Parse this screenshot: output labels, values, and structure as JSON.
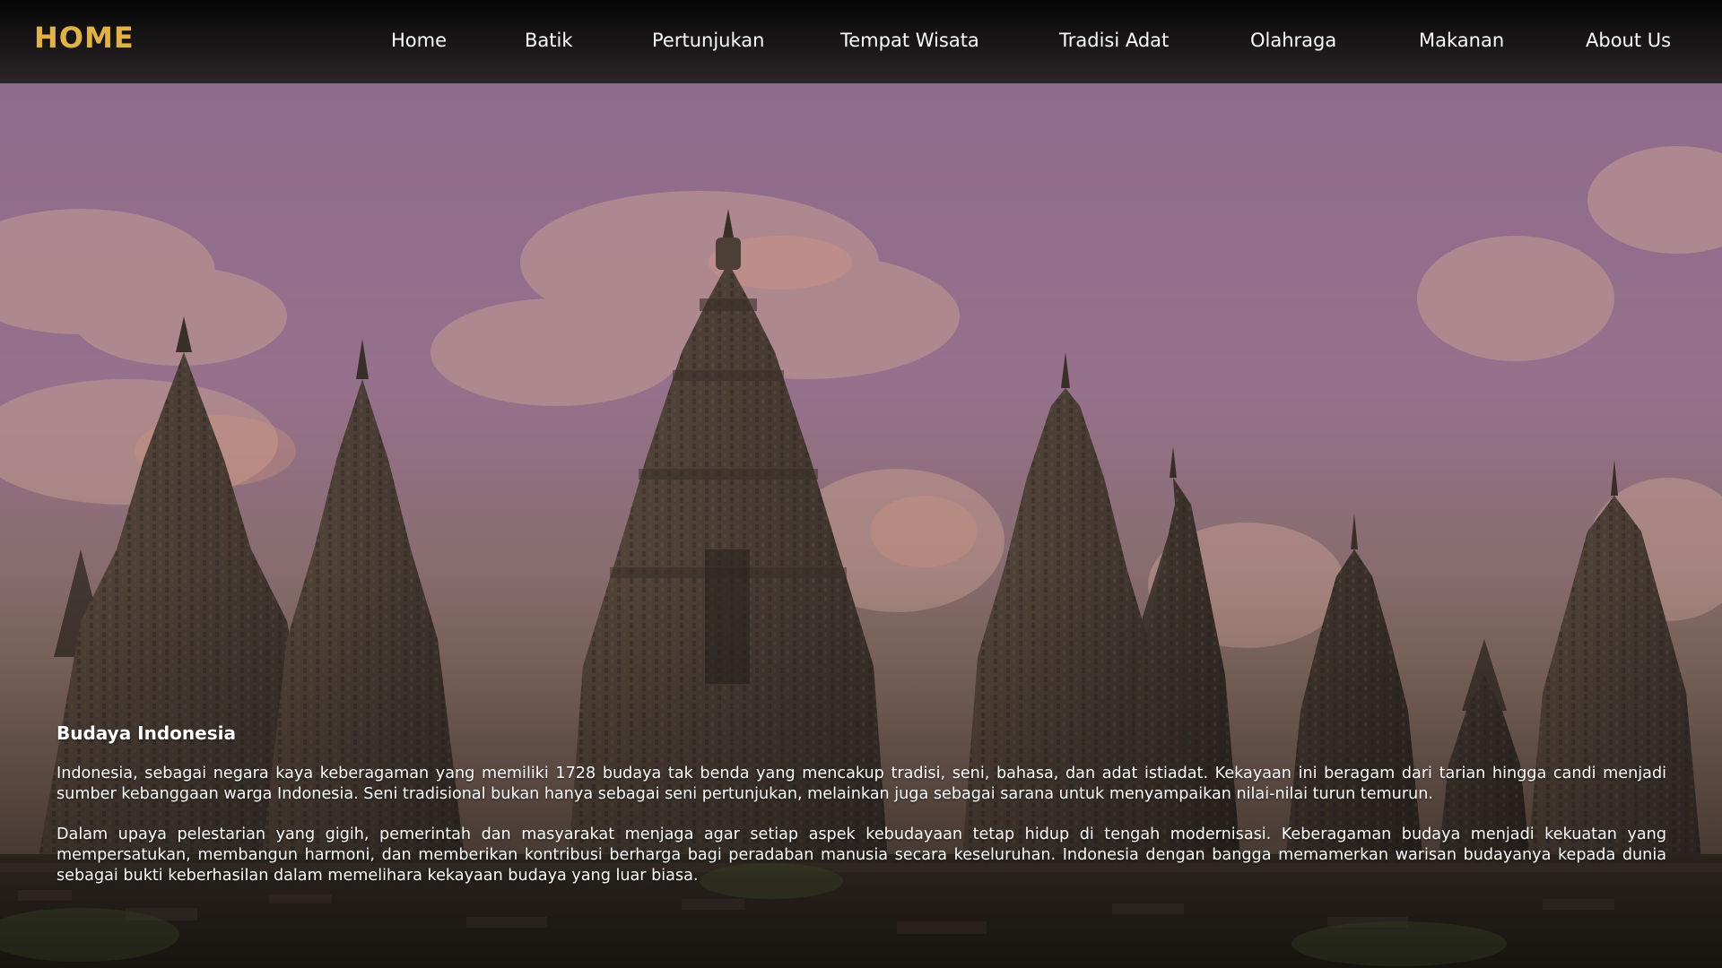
{
  "header": {
    "brand": "HOME",
    "brand_color": "#e2b24a",
    "nav": [
      {
        "label": "Home"
      },
      {
        "label": "Batik"
      },
      {
        "label": "Pertunjukan"
      },
      {
        "label": "Tempat Wisata"
      },
      {
        "label": "Tradisi Adat"
      },
      {
        "label": "Olahraga"
      },
      {
        "label": "Makanan"
      },
      {
        "label": "About Us"
      }
    ]
  },
  "hero": {
    "image": "prambanan-temple-silhouette-purple-sky"
  },
  "content": {
    "title": "Budaya Indonesia",
    "paragraphs": [
      "Indonesia, sebagai negara kaya keberagaman yang memiliki 1728 budaya tak benda yang mencakup tradisi, seni, bahasa, dan adat istiadat. Kekayaan ini beragam dari tarian hingga candi menjadi sumber kebanggaan warga Indonesia. Seni tradisional bukan hanya sebagai seni pertunjukan, melainkan juga sebagai sarana untuk menyampaikan nilai-nilai turun temurun.",
      "Dalam upaya pelestarian yang gigih, pemerintah dan masyarakat menjaga agar setiap aspek kebudayaan tetap hidup di tengah modernisasi. Keberagaman budaya menjadi kekuatan yang mempersatukan, membangun harmoni, dan memberikan kontribusi berharga bagi peradaban manusia secara keseluruhan. Indonesia dengan bangga memamerkan warisan budayanya kepada dunia sebagai bukti keberhasilan dalam memelihara kekayaan budaya yang luar biasa."
    ]
  }
}
